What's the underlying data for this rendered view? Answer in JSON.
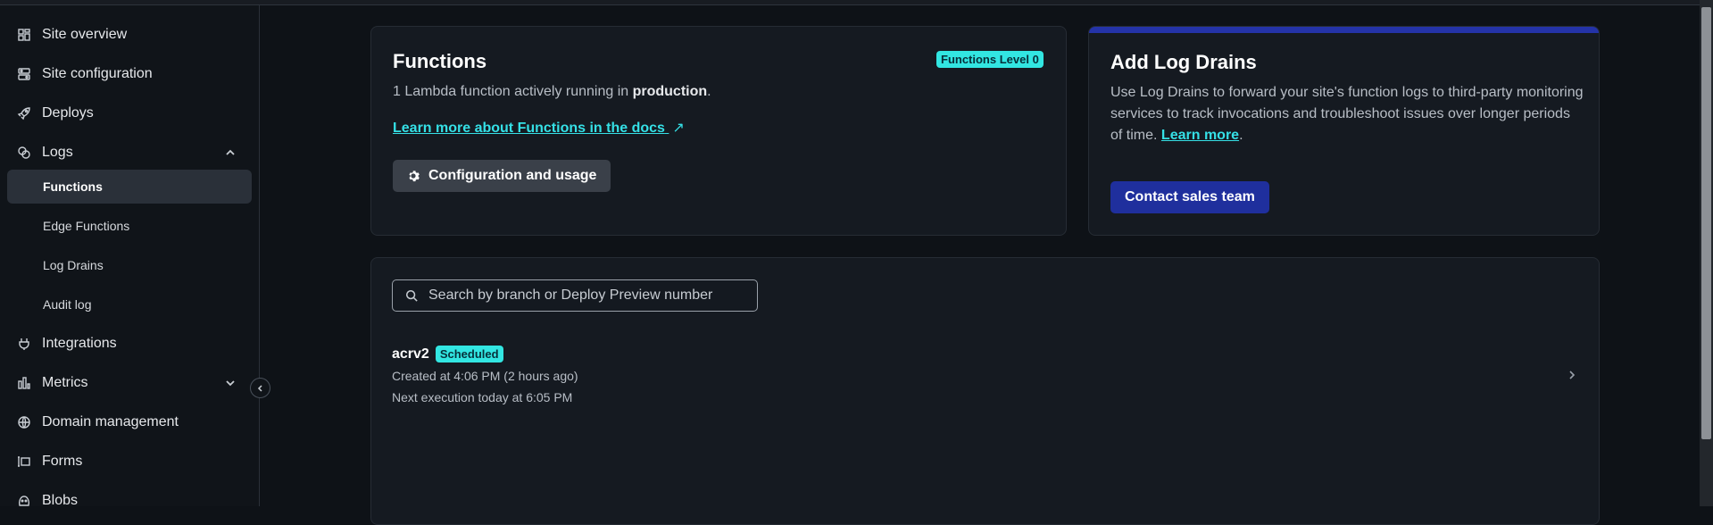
{
  "sidebar": {
    "items": [
      {
        "label": "Site overview",
        "icon": "grid-icon"
      },
      {
        "label": "Site configuration",
        "icon": "sliders-icon"
      },
      {
        "label": "Deploys",
        "icon": "rocket-icon"
      },
      {
        "label": "Logs",
        "icon": "logs-icon"
      },
      {
        "label": "Integrations",
        "icon": "plug-icon"
      },
      {
        "label": "Metrics",
        "icon": "bar-chart-icon"
      },
      {
        "label": "Domain management",
        "icon": "globe-icon"
      },
      {
        "label": "Forms",
        "icon": "form-icon"
      },
      {
        "label": "Blobs",
        "icon": "blob-icon"
      }
    ],
    "logs_children": [
      "Functions",
      "Edge Functions",
      "Log Drains",
      "Audit log"
    ]
  },
  "functions_card": {
    "title": "Functions",
    "badge": "Functions Level 0",
    "desc_prefix": "1 Lambda function actively running in ",
    "desc_bold": "production",
    "desc_suffix": ".",
    "docs_link": "Learn more about Functions in the docs",
    "config_button": "Configuration and usage"
  },
  "log_drains_card": {
    "title": "Add Log Drains",
    "desc": "Use Log Drains to forward your site's function logs to third-party monitoring services to track invocations and troubleshoot issues over longer periods of time.",
    "learn_more": "Learn more",
    "period": ".",
    "button": "Contact sales team"
  },
  "function_list": {
    "search_placeholder": "Search by branch or Deploy Preview number",
    "items": [
      {
        "name": "acrv2",
        "badge": "Scheduled",
        "created": "Created at 4:06 PM (2 hours ago)",
        "next": "Next execution today at 6:05 PM"
      }
    ]
  },
  "colors": {
    "accent": "#32e6e2",
    "link": "#35e0e6",
    "primary_button": "#1f2f9d",
    "log_drains_bar": "#2433a8"
  }
}
